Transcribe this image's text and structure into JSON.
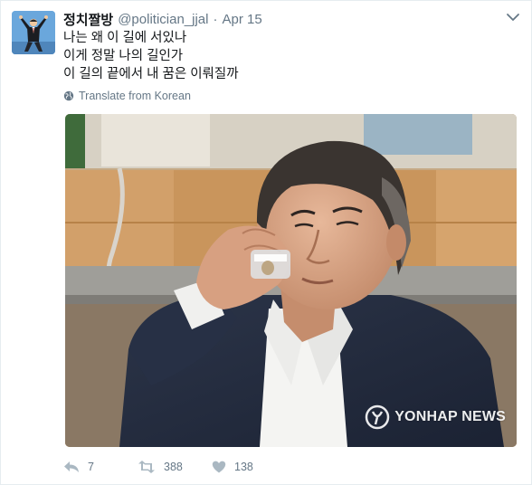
{
  "tweet": {
    "display_name": "정치짤방",
    "handle": "@politician_jjal",
    "separator": "·",
    "timestamp": "Apr 15",
    "lines": [
      "나는 왜 이 길에 서있나",
      "이게 정말 나의 길인가",
      "이 길의 끝에서 내 꿈은 이뤄질까"
    ],
    "translate_label": "Translate from Korean",
    "watermark_text": "YONHAP NEWS"
  },
  "actions": {
    "reply_count": "7",
    "retweet_count": "388",
    "like_count": "138"
  },
  "icons": {
    "caret": "chevron-down-icon",
    "translate": "globe-icon",
    "reply": "reply-icon",
    "retweet": "retweet-icon",
    "like": "heart-icon",
    "watermark_logo": "yonhap-logo"
  },
  "colors": {
    "text": "#14171a",
    "secondary": "#657786",
    "icon": "#aab8c2",
    "border": "#e6ecf0"
  }
}
